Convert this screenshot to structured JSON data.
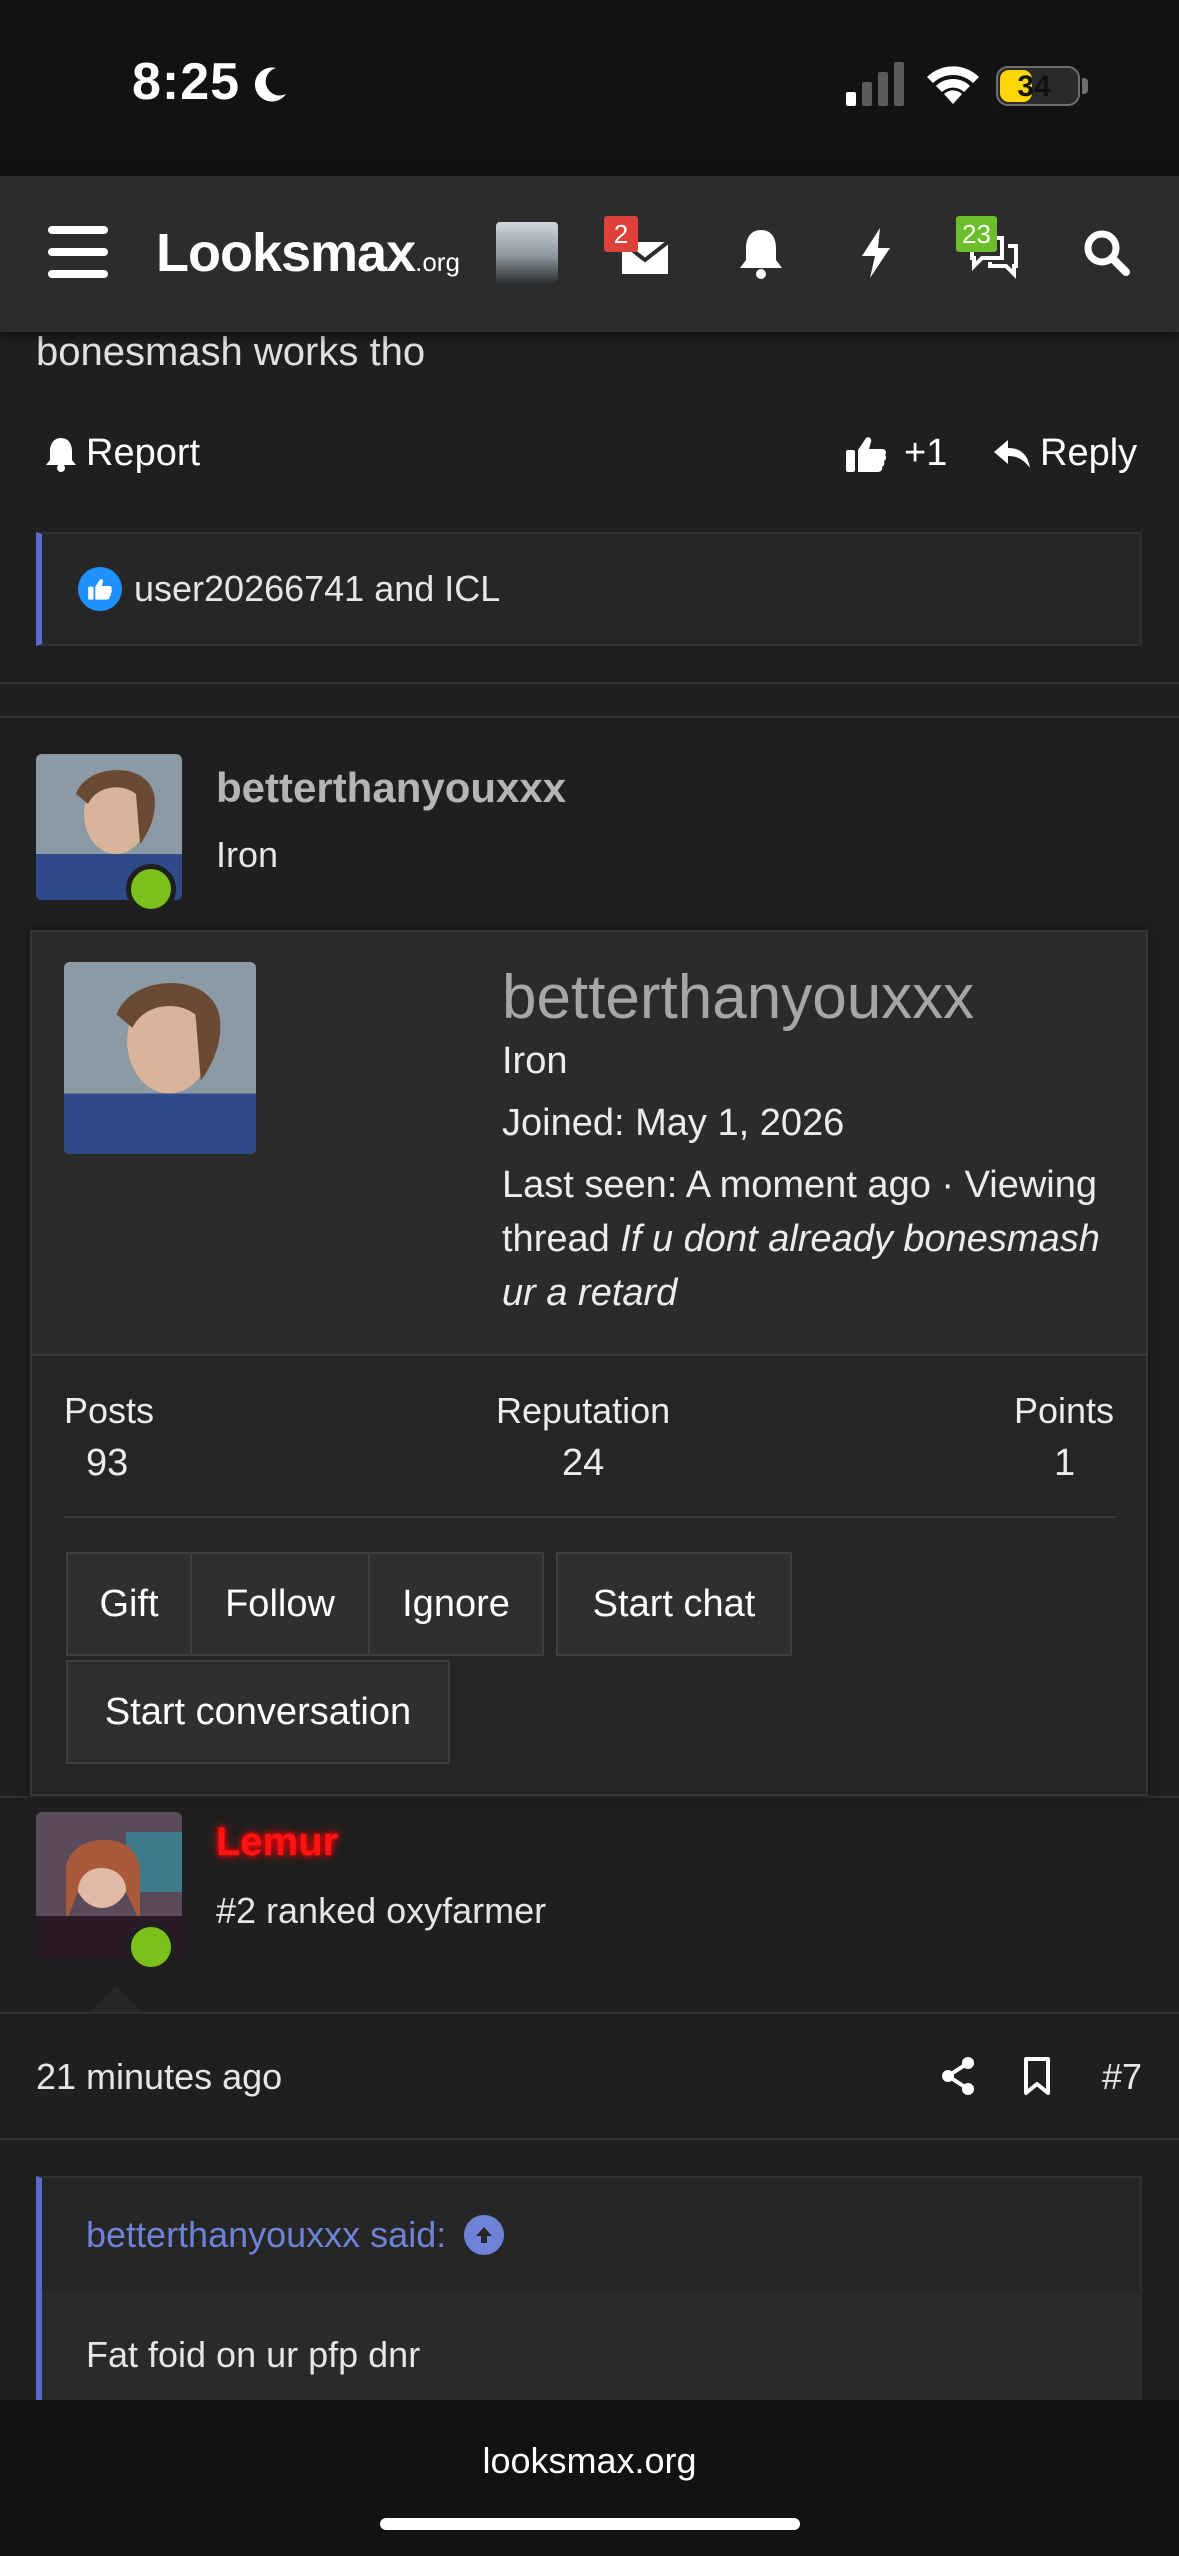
{
  "status_bar": {
    "time": "8:25",
    "battery": "34"
  },
  "nav": {
    "logo": "Looksmax",
    "logo_suffix": ".org",
    "messages_badge": "2",
    "alerts_badge": "23",
    "colors": {
      "messages_badge": "#e0403a",
      "alerts_badge": "#6cbf2a"
    }
  },
  "post_prev": {
    "text": "bonesmash works tho",
    "report_label": "Report",
    "like_count": "+1",
    "reply_label": "Reply",
    "reactions_text": "user20266741 and ICL"
  },
  "post_author": {
    "name": "betterthanyouxxx",
    "title": "Iron"
  },
  "profile_popup": {
    "name": "betterthanyouxxx",
    "title": "Iron",
    "joined": "Joined: May 1, 2026",
    "last_seen_prefix": "Last seen: A moment ago · Viewing thread ",
    "last_seen_thread": "If u dont already bonesmash ur a retard",
    "stats": {
      "posts_label": "Posts",
      "posts_value": "93",
      "reputation_label": "Reputation",
      "reputation_value": "24",
      "points_label": "Points",
      "points_value": "1"
    },
    "buttons": {
      "gift": "Gift",
      "follow": "Follow",
      "ignore": "Ignore",
      "start_chat": "Start chat",
      "start_conversation": "Start conversation"
    }
  },
  "post_second": {
    "author_name": "Lemur",
    "author_title": "#2 ranked oxyfarmer",
    "time": "21 minutes ago",
    "post_number": "#7",
    "quote_author": "betterthanyouxxx said:",
    "quote_text": "Fat foid on ur pfp dnr"
  },
  "url_bar": {
    "url": "looksmax.org"
  }
}
